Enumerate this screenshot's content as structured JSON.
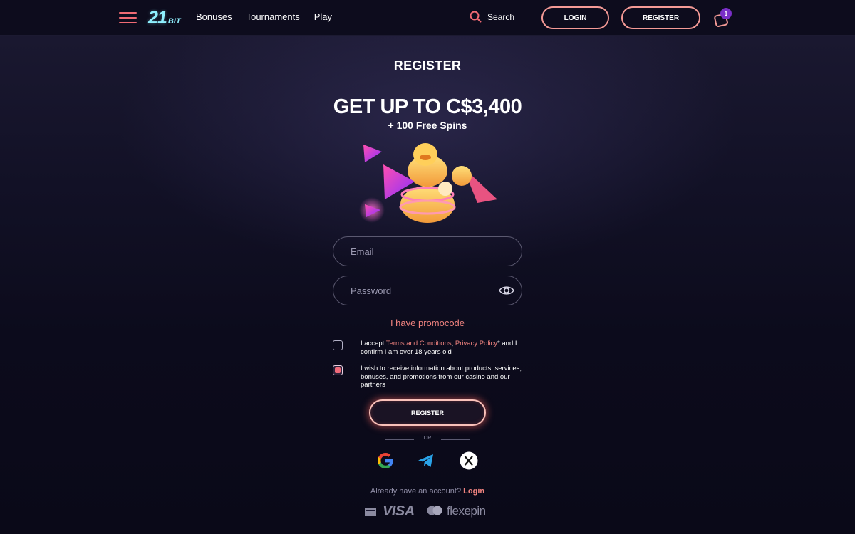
{
  "header": {
    "logo_num": "21",
    "logo_bit": "BIT",
    "nav": [
      "Bonuses",
      "Tournaments",
      "Play"
    ],
    "search_label": "Search",
    "login_label": "LOGIN",
    "register_label": "REGISTER",
    "cart_count": "1"
  },
  "main": {
    "title": "REGISTER",
    "bonus_headline": "GET UP TO C$3,400",
    "bonus_sub": "+ 100 Free Spins",
    "email_placeholder": "Email",
    "password_placeholder": "Password",
    "promo_link": "I have promocode",
    "terms": {
      "prefix": "I accept ",
      "terms_link": "Terms and Conditions",
      "comma": ", ",
      "privacy_link": "Privacy Policy",
      "suffix": "* and I confirm I am over 18 years old",
      "checked": false
    },
    "marketing": {
      "text": "I wish to receive information about products, services, bonuses, and promotions from our casino and our partners",
      "checked": true
    },
    "register_button": "REGISTER",
    "or_text": "OR",
    "social": [
      "google-icon",
      "telegram-icon",
      "x-icon"
    ],
    "already_text": "Already have an account? ",
    "login_link": "Login"
  },
  "payments": {
    "visa": "VISA",
    "flexepin": "flexepin"
  },
  "colors": {
    "accent": "#f0837f",
    "logo": "#8ff0ff",
    "background": "#0b0a1a",
    "badge": "#7a2fc8"
  }
}
